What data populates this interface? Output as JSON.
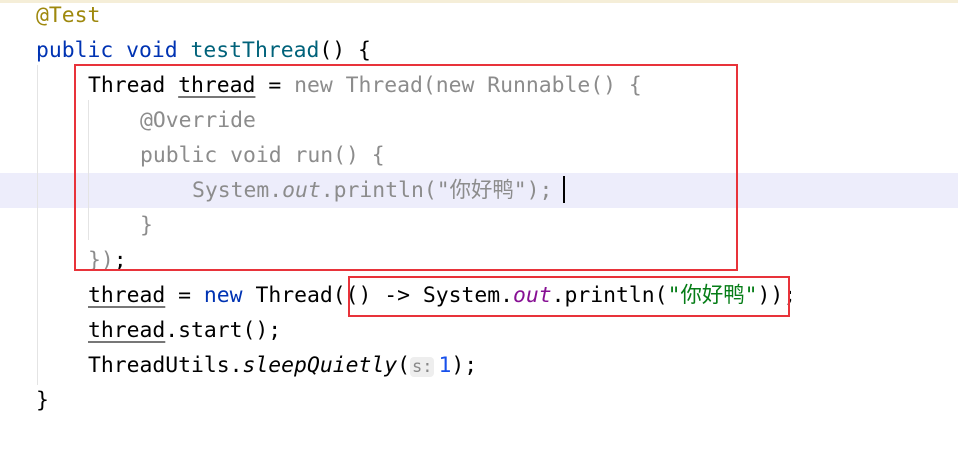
{
  "editor": {
    "highlighted_line": 5,
    "accent_box_color": "#e8333a",
    "lines": [
      {
        "indent": 1,
        "tokens": [
          {
            "t": "@Test",
            "c": "annotation"
          }
        ]
      },
      {
        "indent": 1,
        "tokens": [
          {
            "t": "public void ",
            "c": "kw"
          },
          {
            "t": "testThread",
            "c": "fn"
          },
          {
            "t": "() {",
            "c": ""
          }
        ]
      },
      {
        "indent": 2,
        "tokens": [
          {
            "t": "Thread ",
            "c": ""
          },
          {
            "t": "thread",
            "c": "under"
          },
          {
            "t": " = ",
            "c": ""
          },
          {
            "t": "new Thread(new Runnable() {",
            "c": "gray"
          }
        ]
      },
      {
        "indent": 3,
        "tokens": [
          {
            "t": "@Override",
            "c": "gray"
          }
        ]
      },
      {
        "indent": 3,
        "tokens": [
          {
            "t": "public void run() {",
            "c": "gray"
          }
        ]
      },
      {
        "indent": 4,
        "tokens": [
          {
            "t": "System.",
            "c": "gray"
          },
          {
            "t": "out",
            "c": "gray italic"
          },
          {
            "t": ".println(\"你好鸭\");",
            "c": "gray"
          }
        ]
      },
      {
        "indent": 3,
        "tokens": [
          {
            "t": "}",
            "c": "gray"
          }
        ]
      },
      {
        "indent": 2,
        "tokens": [
          {
            "t": "})",
            "c": "gray"
          },
          {
            "t": ";",
            "c": ""
          }
        ]
      },
      {
        "indent": 2,
        "tokens": [
          {
            "t": "thread",
            "c": "under"
          },
          {
            "t": " = ",
            "c": ""
          },
          {
            "t": "new ",
            "c": "kw"
          },
          {
            "t": "Thread(() -> System.",
            "c": ""
          },
          {
            "t": "out",
            "c": "field"
          },
          {
            "t": ".println(",
            "c": ""
          },
          {
            "t": "\"你好鸭\"",
            "c": "str"
          },
          {
            "t": "));",
            "c": ""
          }
        ]
      },
      {
        "indent": 2,
        "tokens": [
          {
            "t": "thread",
            "c": "under"
          },
          {
            "t": ".start();",
            "c": ""
          }
        ]
      },
      {
        "indent": 2,
        "tokens": [
          {
            "t": "ThreadUtils.",
            "c": ""
          },
          {
            "t": "sleepQuietly",
            "c": "italic"
          },
          {
            "t": "(",
            "c": ""
          },
          {
            "t": "s:",
            "c": "hint"
          },
          {
            "t": "1",
            "c": "num"
          },
          {
            "t": ");",
            "c": ""
          }
        ]
      },
      {
        "indent": 1,
        "tokens": [
          {
            "t": "}",
            "c": ""
          }
        ]
      }
    ]
  }
}
